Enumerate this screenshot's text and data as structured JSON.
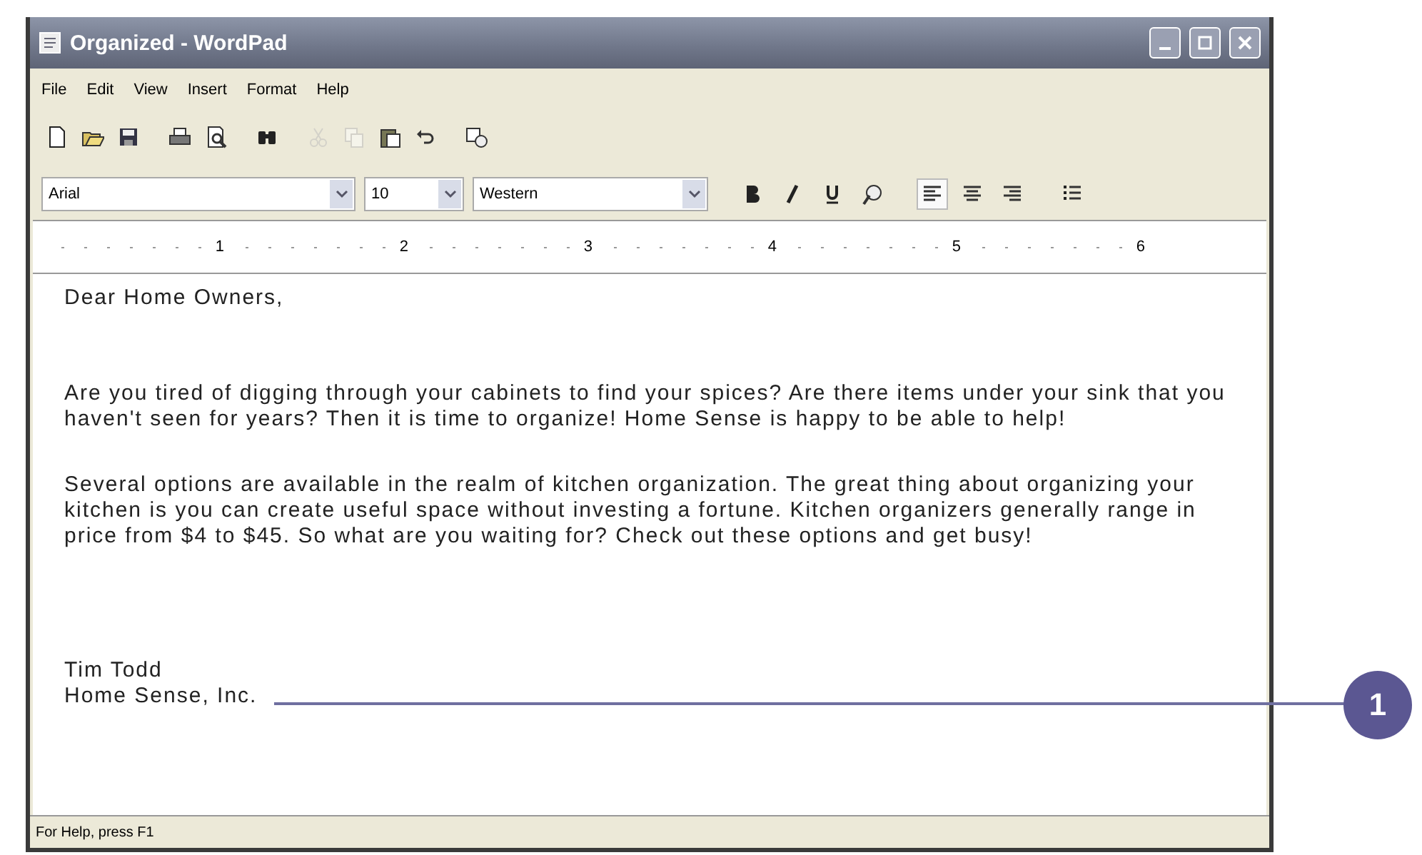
{
  "window": {
    "title": "Organized - WordPad"
  },
  "menu": [
    "File",
    "Edit",
    "View",
    "Insert",
    "Format",
    "Help"
  ],
  "toolbar": [
    {
      "kind": "new",
      "disabled": false
    },
    {
      "kind": "open",
      "disabled": false
    },
    {
      "kind": "save",
      "disabled": false
    },
    {
      "kind": "sep"
    },
    {
      "kind": "print",
      "disabled": false
    },
    {
      "kind": "preview",
      "disabled": false
    },
    {
      "kind": "sep"
    },
    {
      "kind": "find",
      "disabled": false
    },
    {
      "kind": "sep"
    },
    {
      "kind": "cut",
      "disabled": true
    },
    {
      "kind": "copy",
      "disabled": true
    },
    {
      "kind": "paste",
      "disabled": false
    },
    {
      "kind": "undo",
      "disabled": false
    },
    {
      "kind": "sep"
    },
    {
      "kind": "datetime",
      "disabled": false
    }
  ],
  "format_bar": {
    "font": "Arial",
    "size": "10",
    "script": "Western",
    "buttons": [
      {
        "kind": "bold"
      },
      {
        "kind": "italic"
      },
      {
        "kind": "underline"
      },
      {
        "kind": "color"
      },
      {
        "kind": "sep"
      },
      {
        "kind": "align-left",
        "selected": true
      },
      {
        "kind": "align-center",
        "selected": false
      },
      {
        "kind": "align-right",
        "selected": false
      },
      {
        "kind": "sep"
      },
      {
        "kind": "bullets"
      }
    ]
  },
  "ruler": {
    "numbers": [
      "1",
      "2",
      "3",
      "4",
      "5",
      "6"
    ]
  },
  "document": {
    "paragraphs": [
      [
        "Dear Home Owners,"
      ],
      [
        "Are you tired of digging through your cabinets to find your spices? Are there items under your sink that you",
        "haven't seen for years? Then it is time to organize! Home Sense is happy to be able to help!"
      ],
      [
        "Several options are available in the realm of kitchen organization. The great thing about organizing your",
        "kitchen is you can create useful space without investing a fortune. Kitchen organizers generally range in",
        "price from $4 to $45. So what are you waiting for? Check out these options and get busy!"
      ],
      [
        "Tim Todd",
        "Home Sense, Inc."
      ]
    ]
  },
  "status_bar": "For Help, press F1",
  "callout": "1"
}
